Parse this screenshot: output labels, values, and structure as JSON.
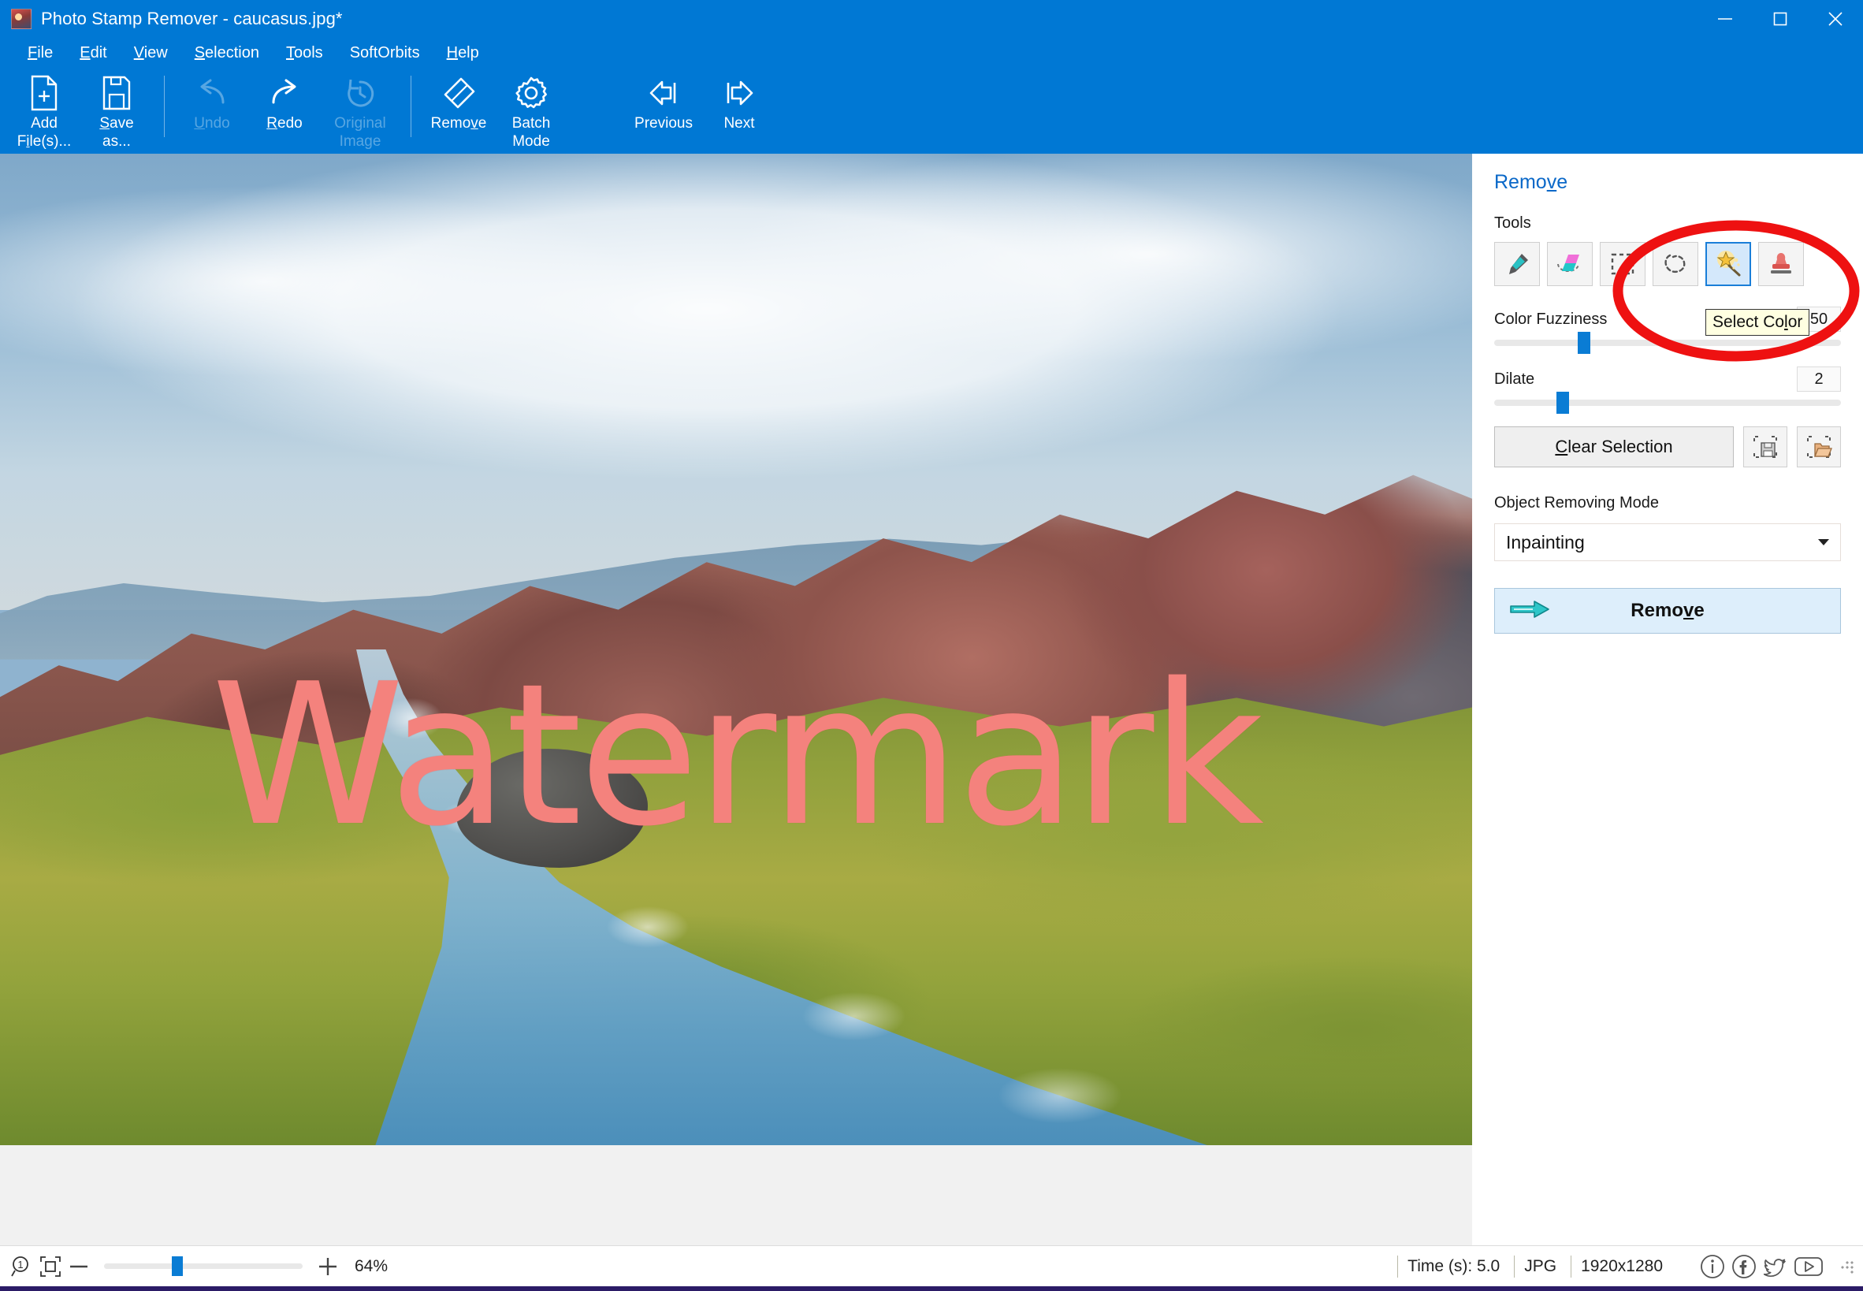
{
  "window": {
    "title": "Photo Stamp Remover - caucasus.jpg*",
    "app_icon": "photo-stamp-remover-icon",
    "minimize_label": "Minimize",
    "maximize_label": "Maximize",
    "close_label": "Close",
    "accent_color": "#0078d4"
  },
  "menubar": {
    "items": [
      {
        "label": "File",
        "mnemonic": "F"
      },
      {
        "label": "Edit",
        "mnemonic": "E"
      },
      {
        "label": "View",
        "mnemonic": "V"
      },
      {
        "label": "Selection",
        "mnemonic": "S"
      },
      {
        "label": "Tools",
        "mnemonic": "T"
      },
      {
        "label": "SoftOrbits",
        "mnemonic": ""
      },
      {
        "label": "Help",
        "mnemonic": "H"
      }
    ]
  },
  "toolbar": {
    "buttons": [
      {
        "label": "Add\nFile(s)...",
        "icon": "add-file-icon",
        "enabled": true,
        "mnemonic": "i"
      },
      {
        "label": "Save\nas...",
        "icon": "save-as-icon",
        "enabled": true,
        "mnemonic": "S"
      },
      {
        "label": "Undo",
        "icon": "undo-icon",
        "enabled": false,
        "mnemonic": "U"
      },
      {
        "label": "Redo",
        "icon": "redo-icon",
        "enabled": true,
        "mnemonic": "R"
      },
      {
        "label": "Original\nImage",
        "icon": "original-image-icon",
        "enabled": false,
        "mnemonic": ""
      },
      {
        "label": "Remove",
        "icon": "eraser-icon",
        "enabled": true,
        "mnemonic": "v"
      },
      {
        "label": "Batch\nMode",
        "icon": "gear-icon",
        "enabled": true,
        "mnemonic": ""
      },
      {
        "label": "Previous",
        "icon": "previous-arrow-icon",
        "enabled": true,
        "mnemonic": ""
      },
      {
        "label": "Next",
        "icon": "next-arrow-icon",
        "enabled": true,
        "mnemonic": ""
      }
    ]
  },
  "canvas": {
    "watermark_text": "Watermark",
    "watermark_color": "#f4827d",
    "image_name": "caucasus.jpg"
  },
  "sidebar": {
    "panel_title": "Remove",
    "panel_title_mnemonic": "v",
    "tools_label": "Tools",
    "tools": [
      {
        "name": "marker-tool",
        "title": "Marker",
        "selected": false
      },
      {
        "name": "eraser-tool",
        "title": "Eraser",
        "selected": false
      },
      {
        "name": "rectangle-select-tool",
        "title": "Rectangle Selection",
        "selected": false
      },
      {
        "name": "lasso-select-tool",
        "title": "Lasso Selection",
        "selected": false
      },
      {
        "name": "magic-wand-select-color-tool",
        "title": "Select Color",
        "selected": true
      },
      {
        "name": "clone-stamp-tool",
        "title": "Stamp",
        "selected": false
      }
    ],
    "color_fuzziness": {
      "label": "Color Fuzziness",
      "value": "50",
      "slider_percent": 25
    },
    "dilate": {
      "label": "Dilate",
      "value": "2",
      "slider_percent": 20
    },
    "clear_selection_label": "Clear Selection",
    "clear_selection_mnemonic": "C",
    "save_selection_icon": "save-selection-icon",
    "load_selection_icon": "load-selection-icon",
    "object_removing_mode": {
      "label": "Object Removing Mode",
      "value": "Inpainting"
    },
    "remove_button": {
      "label": "Remove",
      "mnemonic": "v",
      "icon": "right-arrow-icon"
    },
    "tooltip": {
      "text": "Select Color",
      "mnemonic": "l"
    },
    "annotation": {
      "shape": "ellipse",
      "color": "#ee1111"
    }
  },
  "statusbar": {
    "zoom_icon": "zoom-one-to-one-icon",
    "fit_icon": "fit-to-window-icon",
    "minus_label": "−",
    "plus_label": "+",
    "zoom_percent": "64%",
    "zoom_slider_percent": 36,
    "fields": [
      {
        "name": "time-field",
        "text": "Time (s): 5.0"
      },
      {
        "name": "format-field",
        "text": "JPG"
      },
      {
        "name": "dimensions-field",
        "text": "1920x1280"
      }
    ],
    "social": [
      {
        "name": "info-icon",
        "title": "Info"
      },
      {
        "name": "facebook-icon",
        "title": "Facebook"
      },
      {
        "name": "twitter-icon",
        "title": "Twitter"
      },
      {
        "name": "youtube-icon",
        "title": "YouTube"
      }
    ]
  }
}
